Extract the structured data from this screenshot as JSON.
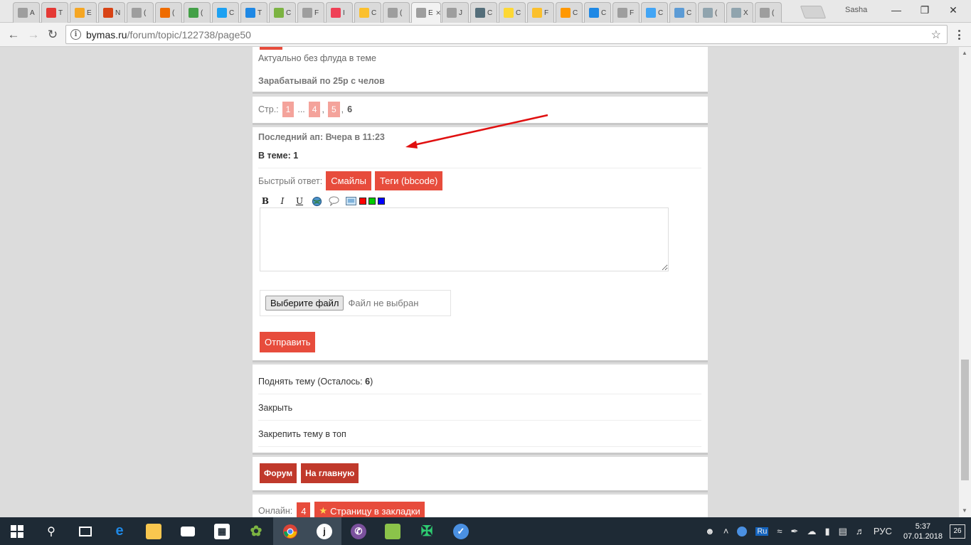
{
  "browser": {
    "tabs": [
      {
        "label": "A",
        "icon": "doc-icon",
        "color": "#9e9e9e"
      },
      {
        "label": "T",
        "icon": "ip-icon",
        "color": "#e53935"
      },
      {
        "label": "E",
        "icon": "sim-icon",
        "color": "#f5a623"
      },
      {
        "label": "N",
        "icon": "tools-icon",
        "color": "#d84315"
      },
      {
        "label": "(",
        "icon": "doc-icon",
        "color": "#9e9e9e"
      },
      {
        "label": "(",
        "icon": "pen-icon",
        "color": "#ef6c00"
      },
      {
        "label": "(",
        "icon": "rss-icon",
        "color": "#43a047"
      },
      {
        "label": "C",
        "icon": "twitter-icon",
        "color": "#1da1f2"
      },
      {
        "label": "T",
        "icon": "globe-icon",
        "color": "#1e88e5"
      },
      {
        "label": "C",
        "icon": "check-icon",
        "color": "#7cb342"
      },
      {
        "label": "F",
        "icon": "doc-icon",
        "color": "#9e9e9e"
      },
      {
        "label": "I",
        "icon": "pocket-icon",
        "color": "#ef4056"
      },
      {
        "label": "C",
        "icon": "at-icon",
        "color": "#fbc02d"
      },
      {
        "label": "(",
        "icon": "doc-icon",
        "color": "#9e9e9e"
      },
      {
        "label": "E",
        "icon": "doc-icon",
        "color": "#9e9e9e",
        "active": true
      },
      {
        "label": "J",
        "icon": "doc-icon",
        "color": "#9e9e9e"
      },
      {
        "label": "C",
        "icon": "rocket-icon",
        "color": "#546e7a"
      },
      {
        "label": "C",
        "icon": "game-icon",
        "color": "#fdd835"
      },
      {
        "label": "F",
        "icon": "beeline-icon",
        "color": "#fbc02d"
      },
      {
        "label": "C",
        "icon": "search-icon",
        "color": "#ff9800"
      },
      {
        "label": "C",
        "icon": "loading-icon",
        "color": "#1e88e5"
      },
      {
        "label": "F",
        "icon": "doc-icon",
        "color": "#9e9e9e"
      },
      {
        "label": "C",
        "icon": "chat-icon",
        "color": "#42a5f5"
      },
      {
        "label": "C",
        "icon": "bot-icon",
        "color": "#5c9bd5"
      },
      {
        "label": "(",
        "icon": "shield-icon",
        "color": "#90a4ae"
      },
      {
        "label": "X",
        "icon": "shield-icon",
        "color": "#90a4ae"
      },
      {
        "label": "(",
        "icon": "doc-icon",
        "color": "#9e9e9e"
      }
    ],
    "profile": "Sasha",
    "url_host": "bymas.ru",
    "url_path": "/forum/topic/122738/page50"
  },
  "page": {
    "top_card": {
      "line1": "Актуально без флуда в теме",
      "line2": "Зарабатывай по 25р с челов"
    },
    "pager": {
      "label": "Стр.:",
      "p1": "1",
      "ellipsis": "...",
      "p4": "4",
      "sep1": ",",
      "p5": "5",
      "sep2": ",",
      "current": "6"
    },
    "reply": {
      "last_up": "Последний ап: Вчера в 11:23",
      "in_topic": "В теме: 1",
      "quick_reply_label": "Быстрый ответ:",
      "smiles_btn": "Смайлы",
      "tags_btn": "Теги (bbcode)",
      "choose_file": "Выберите файл",
      "no_file": "Файл не выбран",
      "send_btn": "Отправить",
      "colors": [
        "#ff0000",
        "#00cc00",
        "#0000ff"
      ]
    },
    "actions": {
      "raise_prefix": "Поднять тему (Осталось: ",
      "raise_count": "6",
      "raise_suffix": ")",
      "close": "Закрыть",
      "pin": "Закрепить тему в топ"
    },
    "nav": {
      "forum": "Форум",
      "home": "На главную"
    },
    "online": {
      "label": "Онлайн:",
      "count": "4",
      "bookmark": "Страницу в закладки"
    }
  },
  "taskbar": {
    "lang": "РУС",
    "kb": "Ru",
    "time": "5:37",
    "date": "07.01.2018",
    "notifications": "26"
  }
}
